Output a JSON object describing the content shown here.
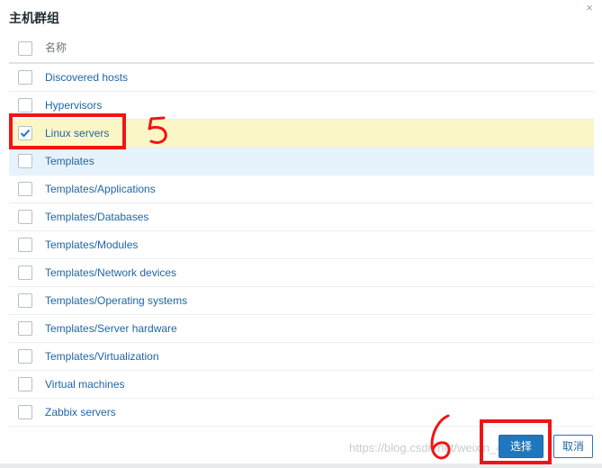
{
  "dialog": {
    "title": "主机群组",
    "close_glyph": "×"
  },
  "table": {
    "header": "名称",
    "rows": [
      {
        "label": "Discovered hosts",
        "checked": false
      },
      {
        "label": "Hypervisors",
        "checked": false
      },
      {
        "label": "Linux servers",
        "checked": true
      },
      {
        "label": "Templates",
        "checked": false
      },
      {
        "label": "Templates/Applications",
        "checked": false
      },
      {
        "label": "Templates/Databases",
        "checked": false
      },
      {
        "label": "Templates/Modules",
        "checked": false
      },
      {
        "label": "Templates/Network devices",
        "checked": false
      },
      {
        "label": "Templates/Operating systems",
        "checked": false
      },
      {
        "label": "Templates/Server hardware",
        "checked": false
      },
      {
        "label": "Templates/Virtualization",
        "checked": false
      },
      {
        "label": "Virtual machines",
        "checked": false
      },
      {
        "label": "Zabbix servers",
        "checked": false
      }
    ]
  },
  "footer": {
    "select_label": "选择",
    "cancel_label": "取消",
    "watermark": "https://blog.csdn.net/weixin_453…"
  },
  "annotations": {
    "step_5": "5",
    "step_6": "6"
  },
  "colors": {
    "accent": "#1f77c0",
    "link": "#1f65a6",
    "selected_row": "#fbf6c6",
    "hover_row": "#e7f3fc",
    "annotation": "#f01515"
  }
}
